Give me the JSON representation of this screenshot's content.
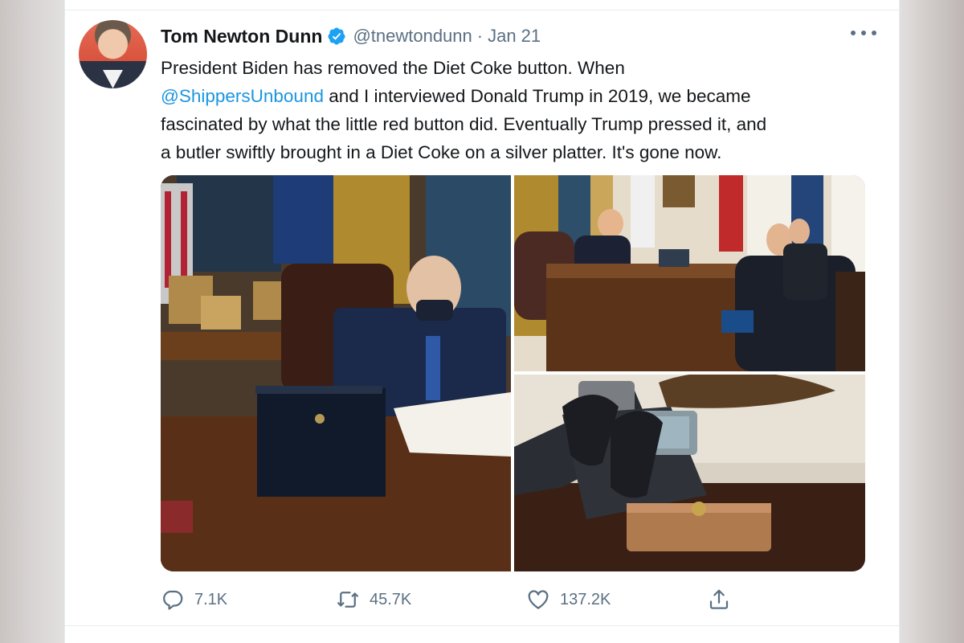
{
  "tweet": {
    "author": {
      "name": "Tom Newton Dunn",
      "handle": "@tnewtondunn",
      "verified": true
    },
    "separator": "·",
    "date": "Jan 21",
    "text": {
      "line1": "President Biden has removed the Diet Coke button. When",
      "mention": "@ShippersUnbound",
      "line2_rest": " and I interviewed Donald Trump in 2019, we became",
      "line3": "fascinated by what the little red button did. Eventually Trump pressed it, and",
      "line4": "a butler swiftly brought in a Diet Coke on a silver platter. It's gone now."
    },
    "media": [
      "biden-desk-photo",
      "trump-interview-photo",
      "desk-phones-button-photo"
    ],
    "stats": {
      "replies": "7.1K",
      "retweets": "45.7K",
      "likes": "137.2K"
    }
  },
  "colors": {
    "accent": "#1da1f2",
    "mention": "#1b95e0",
    "text": "#14171a",
    "secondary": "#5b7083"
  },
  "icons": {
    "verified": "verified-badge-icon",
    "more": "more-options-icon",
    "reply": "reply-icon",
    "retweet": "retweet-icon",
    "like": "heart-icon",
    "share": "share-icon"
  }
}
